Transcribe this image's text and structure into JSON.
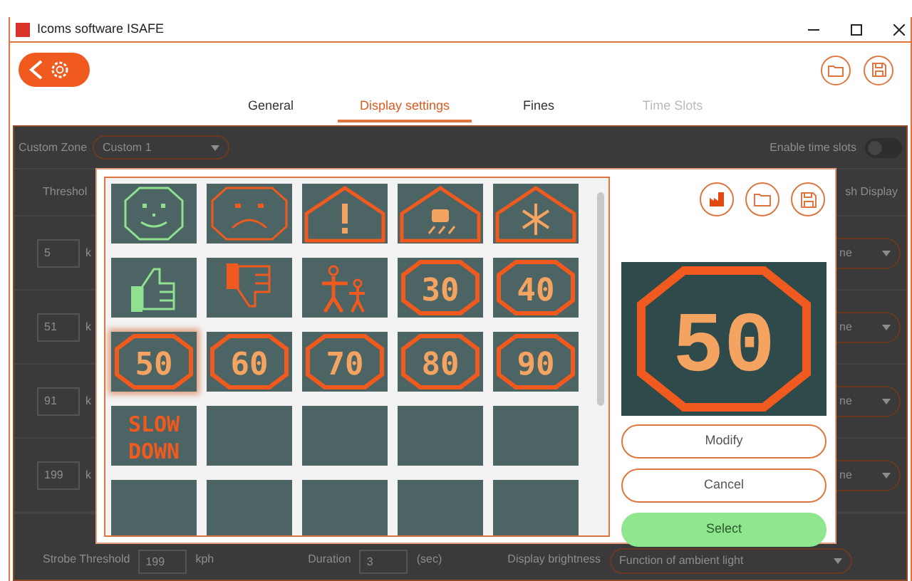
{
  "window": {
    "title": "Icoms software ISAFE"
  },
  "tabs": [
    {
      "label": "General",
      "selected": false,
      "disabled": false
    },
    {
      "label": "Display settings",
      "selected": true,
      "disabled": false
    },
    {
      "label": "Fines",
      "selected": false,
      "disabled": false
    },
    {
      "label": "Time Slots",
      "selected": false,
      "disabled": true
    }
  ],
  "zone": {
    "label": "Custom Zone",
    "value": "Custom 1"
  },
  "time_slots": {
    "label": "Enable time slots",
    "on": false
  },
  "thresholds": {
    "header": "Threshol",
    "display_header": "sh Display",
    "rows": [
      {
        "value": "5",
        "unit": "k",
        "display": "ne"
      },
      {
        "value": "51",
        "unit": "k",
        "display": "ne"
      },
      {
        "value": "91",
        "unit": "k",
        "display": "ne"
      },
      {
        "value": "199",
        "unit": "k",
        "display": "ne"
      }
    ]
  },
  "strobe": {
    "label": "Strobe Threshold",
    "value": "199",
    "unit": "kph"
  },
  "duration": {
    "label": "Duration",
    "value": "3",
    "unit": "(sec)"
  },
  "brightness": {
    "label": "Display brightness",
    "value": "Function of ambient light"
  },
  "dialog": {
    "tiles": [
      {
        "kind": "smile",
        "selected": false
      },
      {
        "kind": "frown",
        "selected": false
      },
      {
        "kind": "warning",
        "selected": false
      },
      {
        "kind": "slippery",
        "selected": false
      },
      {
        "kind": "ice",
        "selected": false
      },
      {
        "kind": "thumbs_up",
        "selected": false
      },
      {
        "kind": "thumbs_down",
        "selected": false
      },
      {
        "kind": "children",
        "selected": false
      },
      {
        "kind": "speed",
        "text": "30",
        "selected": false
      },
      {
        "kind": "speed",
        "text": "40",
        "selected": false
      },
      {
        "kind": "speed",
        "text": "50",
        "selected": true
      },
      {
        "kind": "speed",
        "text": "60",
        "selected": false
      },
      {
        "kind": "speed",
        "text": "70",
        "selected": false
      },
      {
        "kind": "speed",
        "text": "80",
        "selected": false
      },
      {
        "kind": "speed",
        "text": "90",
        "selected": false
      },
      {
        "kind": "words",
        "text": "SLOW",
        "text2": "DOWN",
        "selected": false
      },
      {
        "kind": "empty",
        "selected": false
      },
      {
        "kind": "empty",
        "selected": false
      },
      {
        "kind": "empty",
        "selected": false
      },
      {
        "kind": "empty",
        "selected": false
      },
      {
        "kind": "empty",
        "selected": false
      },
      {
        "kind": "empty",
        "selected": false
      },
      {
        "kind": "empty",
        "selected": false
      },
      {
        "kind": "empty",
        "selected": false
      },
      {
        "kind": "empty",
        "selected": false
      }
    ],
    "preview": {
      "text": "50"
    },
    "buttons": [
      {
        "label": "Modify",
        "kind": "outline"
      },
      {
        "label": "Cancel",
        "kind": "outline"
      },
      {
        "label": "Select",
        "kind": "primary"
      }
    ]
  }
}
